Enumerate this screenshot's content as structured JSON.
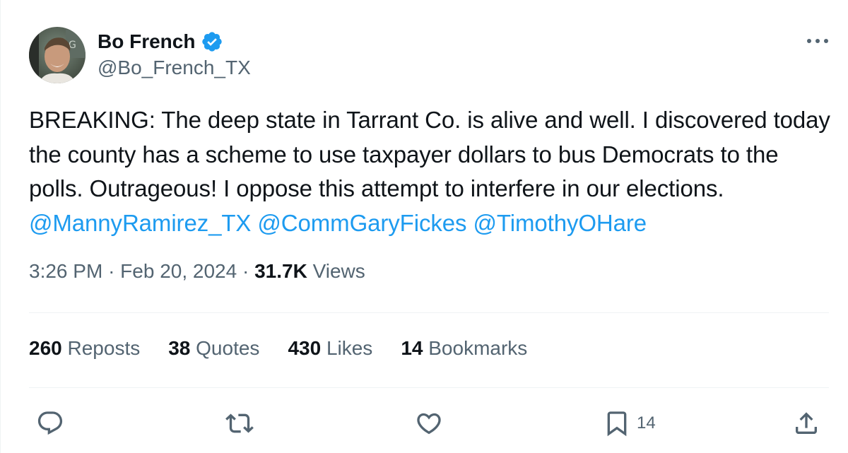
{
  "author": {
    "name": "Bo French",
    "handle": "@Bo_French_TX",
    "verified": true
  },
  "tweet": {
    "segments": [
      {
        "type": "text",
        "text": "BREAKING: The deep state in Tarrant Co. is alive and well. I discovered today the county has a scheme to use taxpayer dollars to bus Democrats to the polls. Outrageous! I oppose this attempt to interfere in our elections. "
      },
      {
        "type": "mention",
        "text": "@MannyRamirez_TX"
      },
      {
        "type": "text",
        "text": " "
      },
      {
        "type": "mention",
        "text": "@CommGaryFickes"
      },
      {
        "type": "text",
        "text": " "
      },
      {
        "type": "mention",
        "text": "@TimothyOHare"
      }
    ]
  },
  "meta": {
    "time": "3:26 PM",
    "separator": "·",
    "date": "Feb 20, 2024",
    "views_count": "31.7K",
    "views_label": "Views"
  },
  "stats": [
    {
      "count": "260",
      "label": "Reposts"
    },
    {
      "count": "38",
      "label": "Quotes"
    },
    {
      "count": "430",
      "label": "Likes"
    },
    {
      "count": "14",
      "label": "Bookmarks"
    }
  ],
  "actions": {
    "reply": {
      "icon": "reply-icon",
      "count": ""
    },
    "repost": {
      "icon": "repost-icon",
      "count": ""
    },
    "like": {
      "icon": "heart-icon",
      "count": ""
    },
    "bookmark": {
      "icon": "bookmark-icon",
      "count": "14"
    },
    "share": {
      "icon": "share-icon"
    }
  },
  "colors": {
    "accent": "#1d9bf0",
    "text": "#0f1419",
    "secondary": "#536471",
    "divider": "#eff3f4"
  }
}
